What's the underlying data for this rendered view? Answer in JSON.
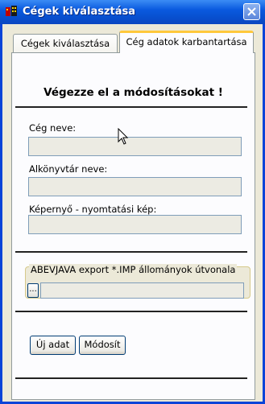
{
  "window": {
    "title": "Cégek kiválasztása"
  },
  "tabs": [
    {
      "label": "Cégek kiválasztása",
      "active": false
    },
    {
      "label": "Cég adatok karbantartása",
      "active": true
    }
  ],
  "form": {
    "heading": "Végezze el a módosításokat !",
    "fields": [
      {
        "label": "Cég neve:",
        "value": ""
      },
      {
        "label": "Alkönyvtár neve:",
        "value": ""
      },
      {
        "label": "Képernyő - nyomtatási kép:",
        "value": ""
      }
    ],
    "export": {
      "label": "ABEVJAVA export *.IMP állományok útvonala",
      "browse_label": "...",
      "path": ""
    },
    "buttons": {
      "new_label": "Új adat",
      "modify_label": "Módosít"
    }
  }
}
